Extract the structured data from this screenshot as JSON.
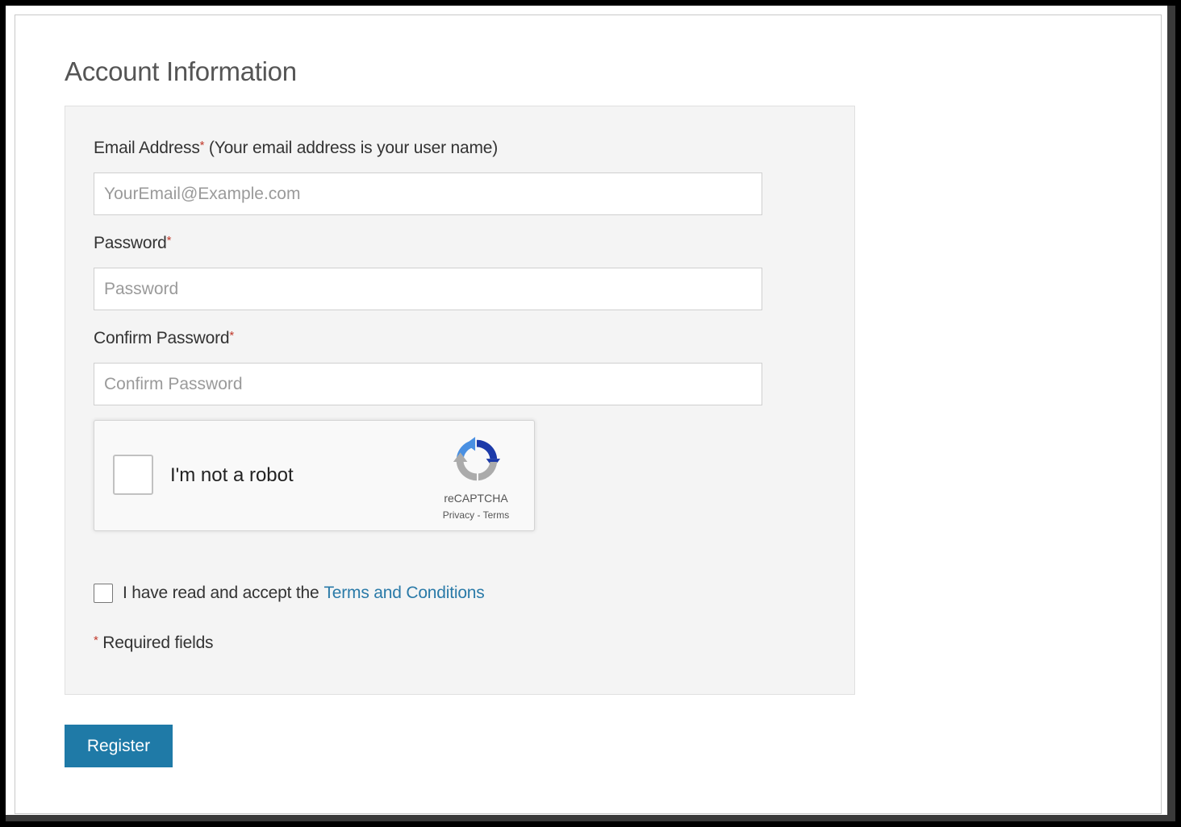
{
  "page": {
    "title": "Account Information"
  },
  "form": {
    "email": {
      "label": "Email Address",
      "required_mark": "*",
      "hint": " (Your email address is your user name)",
      "placeholder": "YourEmail@Example.com",
      "value": ""
    },
    "password": {
      "label": "Password",
      "required_mark": "*",
      "placeholder": "Password",
      "value": ""
    },
    "confirm_password": {
      "label": "Confirm Password",
      "required_mark": "*",
      "placeholder": "Confirm Password",
      "value": ""
    },
    "recaptcha": {
      "label": "I'm not a robot",
      "brand": "reCAPTCHA",
      "privacy_link": "Privacy",
      "separator": " - ",
      "terms_link": "Terms",
      "checked": false
    },
    "terms": {
      "text": "I have read and accept the",
      "link": "Terms and Conditions",
      "checked": false
    },
    "required_note": {
      "mark": "*",
      "text": " Required fields"
    },
    "register_label": "Register"
  },
  "colors": {
    "accent": "#1f7aa7",
    "link": "#2a7aa8",
    "required": "#c0392b",
    "panel_bg": "#f4f4f4"
  },
  "icons": {
    "recaptcha_logo": "recaptcha-logo-icon",
    "checkbox": "checkbox-icon"
  }
}
